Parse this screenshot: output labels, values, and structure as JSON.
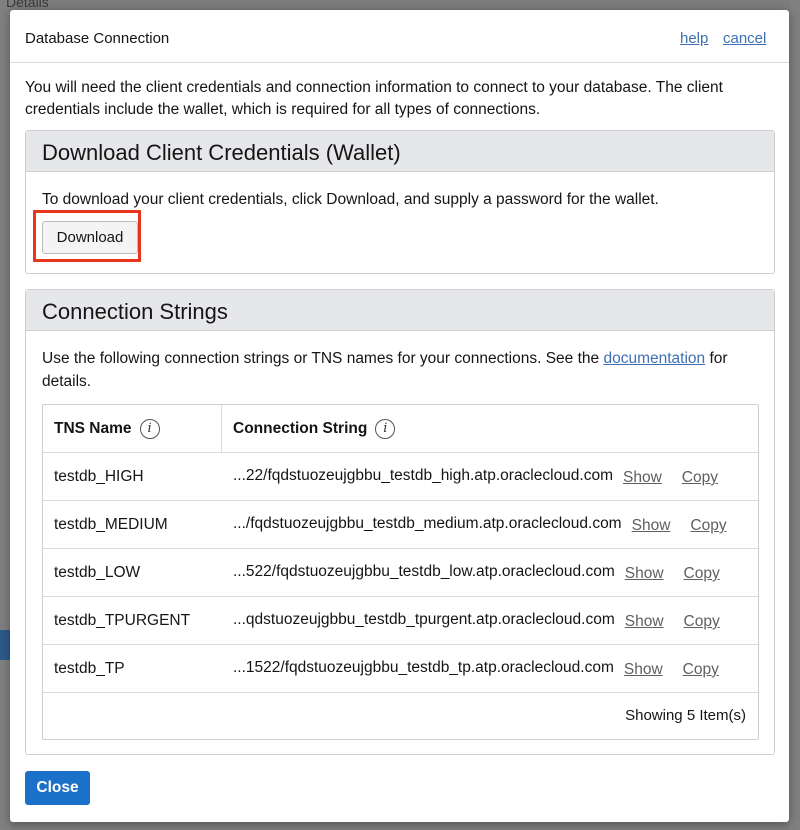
{
  "background": {
    "top_text": "Details"
  },
  "dialog": {
    "title": "Database Connection",
    "help_label": "help",
    "cancel_label": "cancel",
    "intro": "You will need the client credentials and connection information to connect to your database. The client credentials include the wallet, which is required for all types of connections."
  },
  "wallet_panel": {
    "title": "Download Client Credentials (Wallet)",
    "text": "To download your client credentials, click Download, and supply a password for the wallet.",
    "download_label": "Download",
    "highlight_color": "#e8361d"
  },
  "conn_panel": {
    "title": "Connection Strings",
    "text_before": "Use the following connection strings or TNS names for your connections. See the ",
    "link_label": "documentation",
    "text_after": " for details."
  },
  "table": {
    "headers": {
      "tns_name": "TNS Name",
      "conn_string": "Connection String",
      "info_glyph": "i"
    },
    "rows": [
      {
        "name": "testdb_HIGH",
        "conn": "...22/fqdstuozeujgbbu_testdb_high.atp.oraclecloud.com",
        "show": "Show",
        "copy": "Copy"
      },
      {
        "name": "testdb_MEDIUM",
        "conn": ".../fqdstuozeujgbbu_testdb_medium.atp.oraclecloud.com",
        "show": "Show",
        "copy": "Copy"
      },
      {
        "name": "testdb_LOW",
        "conn": "...522/fqdstuozeujgbbu_testdb_low.atp.oraclecloud.com",
        "show": "Show",
        "copy": "Copy"
      },
      {
        "name": "testdb_TPURGENT",
        "conn": "...qdstuozeujgbbu_testdb_tpurgent.atp.oraclecloud.com",
        "show": "Show",
        "copy": "Copy"
      },
      {
        "name": "testdb_TP",
        "conn": "...1522/fqdstuozeujgbbu_testdb_tp.atp.oraclecloud.com",
        "show": "Show",
        "copy": "Copy"
      }
    ],
    "footer": "Showing 5 Item(s)"
  },
  "footer": {
    "close_label": "Close"
  },
  "colors": {
    "primary_button": "#1b70c7",
    "link": "#3f6fb5",
    "overlay": "#7d7d7d"
  }
}
